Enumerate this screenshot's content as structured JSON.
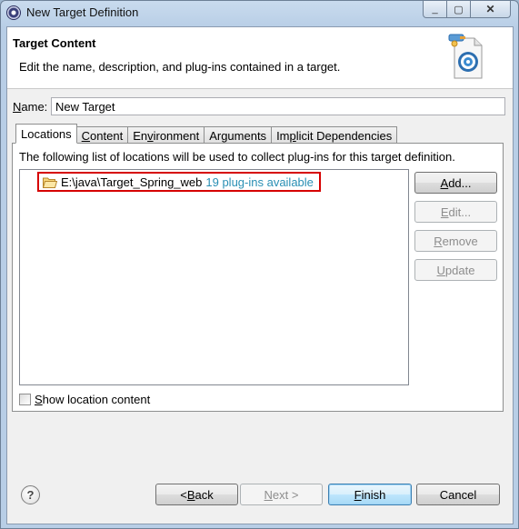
{
  "window": {
    "title": "New Target Definition",
    "controls": {
      "minimize": "_",
      "maximize": "▢",
      "close": "✕"
    }
  },
  "header": {
    "title": "Target Content",
    "description": "Edit the name, description, and plug-ins contained in a target.",
    "icon": "target-definition-icon"
  },
  "name_field": {
    "label_underlined": "N",
    "label_rest": "ame:",
    "value": "New Target"
  },
  "tabs": [
    {
      "label": "Locations",
      "u": "",
      "rest": "Locations",
      "active": true
    },
    {
      "label": "Content",
      "u": "C",
      "rest": "ontent",
      "active": false
    },
    {
      "label": "Environment",
      "pre": "En",
      "u": "v",
      "rest": "ironment",
      "active": false
    },
    {
      "label": "Arguments",
      "pre": "Ar",
      "u": "g",
      "rest": "uments",
      "active": false
    },
    {
      "label": "Implicit Dependencies",
      "pre": "Im",
      "u": "p",
      "rest": "licit Dependencies",
      "active": false
    }
  ],
  "locations": {
    "description": "The following list of locations will be used to collect plug-ins for this target definition.",
    "items": [
      {
        "path": "E:\\java\\Target_Spring_web",
        "status": "19 plug-ins available",
        "icon": "folder-icon"
      }
    ],
    "buttons": {
      "add": {
        "u": "A",
        "rest": "dd...",
        "enabled": true
      },
      "edit": {
        "u": "E",
        "rest": "dit...",
        "enabled": false
      },
      "remove": {
        "u": "R",
        "rest": "emove",
        "enabled": false
      },
      "update": {
        "u": "U",
        "rest": "pdate",
        "enabled": false
      }
    },
    "show_content": {
      "u": "S",
      "rest": "how location content",
      "checked": false
    }
  },
  "footer": {
    "help_icon": "?",
    "back": {
      "pre": "< ",
      "u": "B",
      "rest": "ack",
      "enabled": true
    },
    "next": {
      "u": "N",
      "rest": "ext >",
      "enabled": false
    },
    "finish": {
      "u": "F",
      "rest": "inish",
      "enabled": true
    },
    "cancel": {
      "label": "Cancel",
      "enabled": true
    }
  }
}
